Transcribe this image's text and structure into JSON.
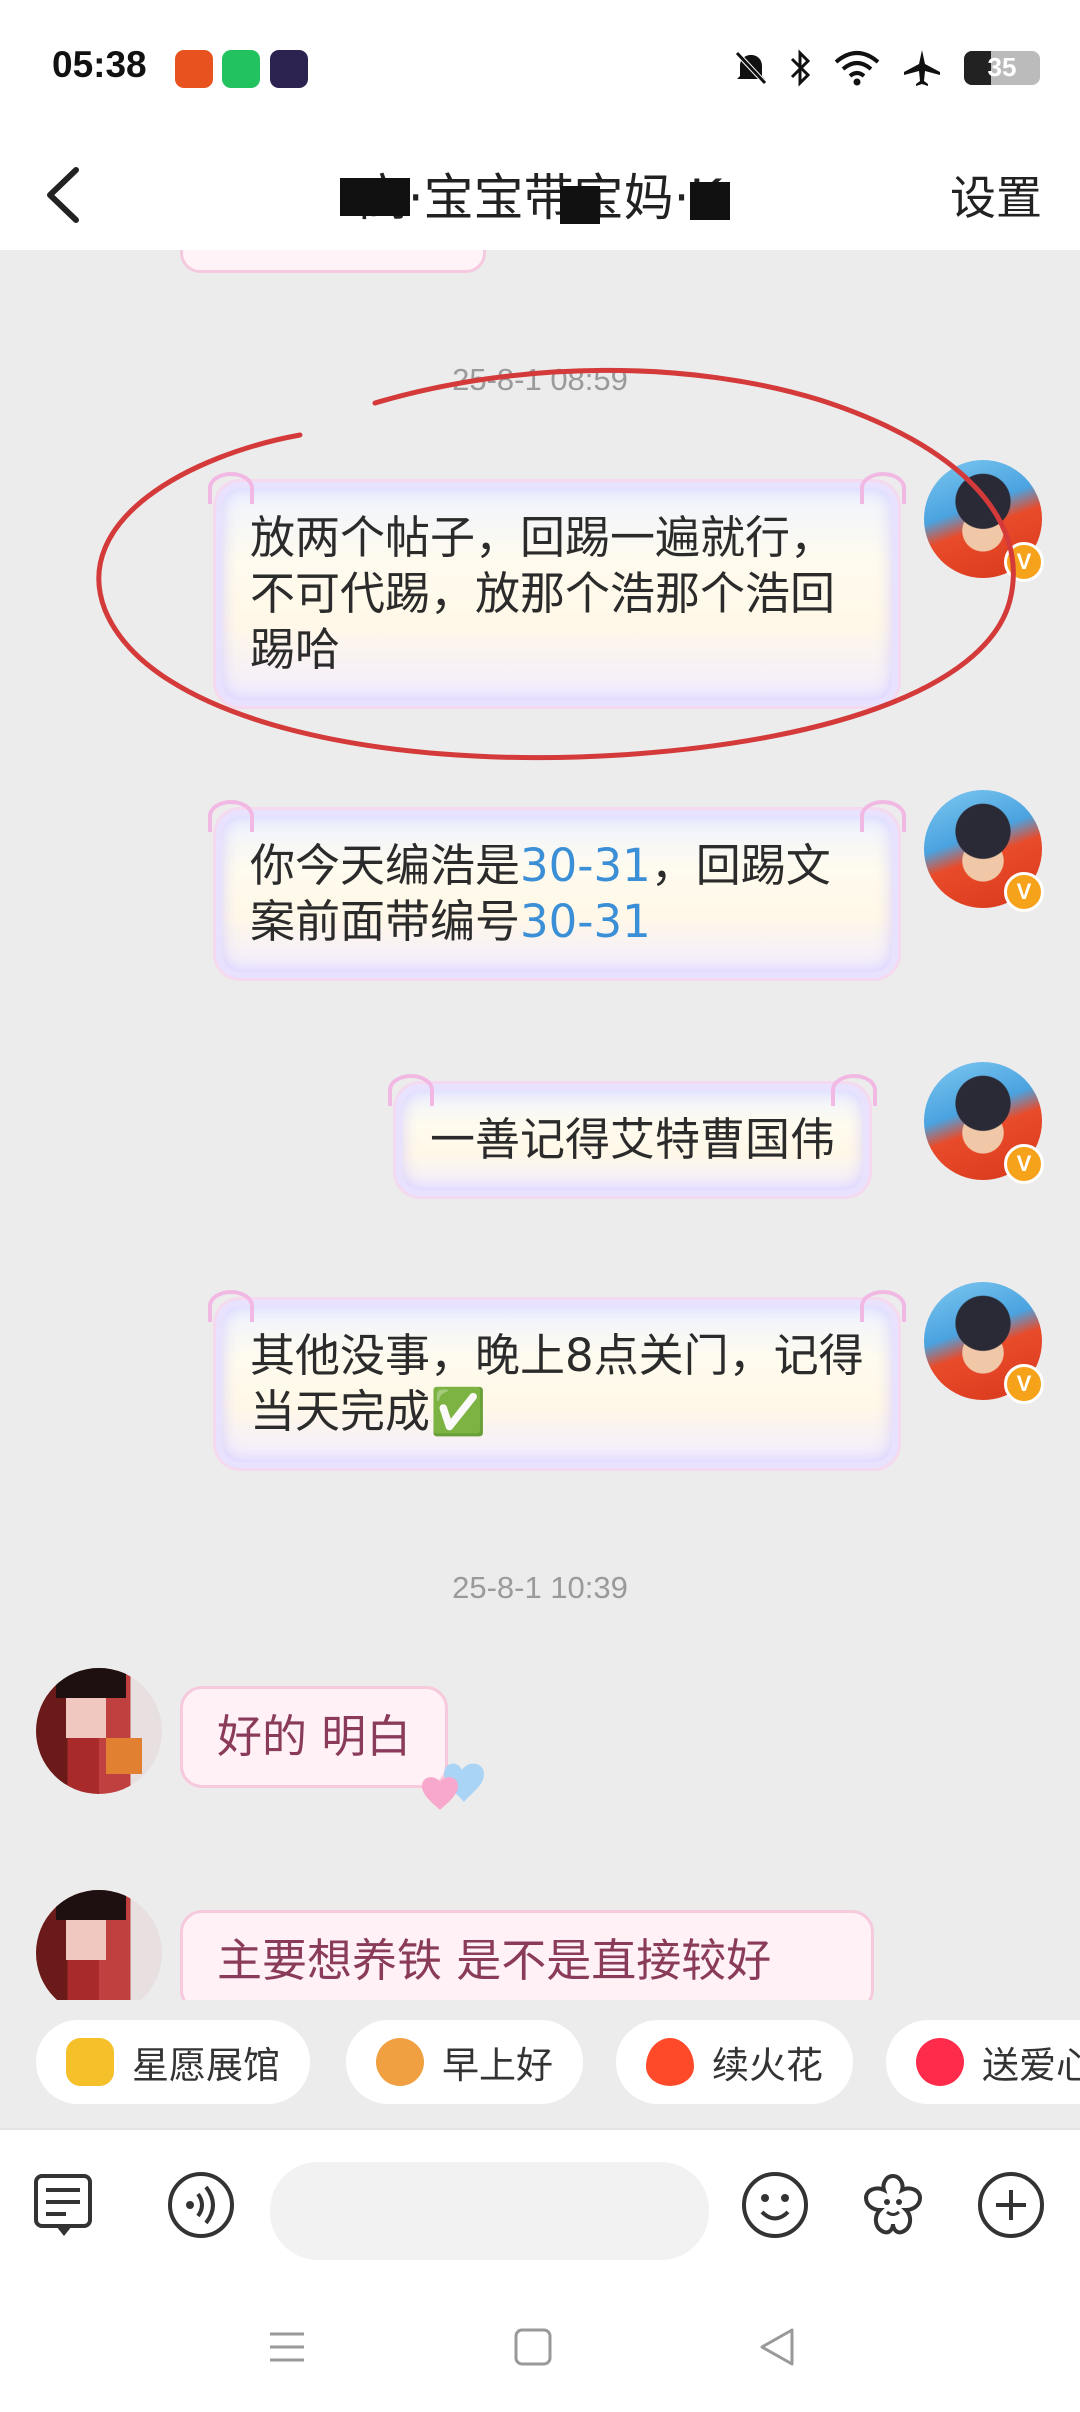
{
  "status_bar": {
    "time": "05:38",
    "battery_level": "35",
    "battery_fraction": 0.35
  },
  "header": {
    "title": "高·宝宝带宝妈·K",
    "settings_label": "设置",
    "back_icon": "chevron-left-icon"
  },
  "messages": [
    {
      "type": "timestamp",
      "text": "25-8-1 08:59"
    },
    {
      "type": "outgoing",
      "text": "放两个帖子，回踢一遍就行，不可代踢，放那个浩那个浩回踢哈"
    },
    {
      "type": "outgoing",
      "parts": [
        "你今天编浩是",
        "30-31",
        "，回踢文案前面带编号",
        "30-31"
      ]
    },
    {
      "type": "outgoing",
      "text": "一善记得艾特曹国伟"
    },
    {
      "type": "outgoing",
      "text": "其他没事，晚上8点关门，记得当天完成✅"
    },
    {
      "type": "timestamp",
      "text": "25-8-1 10:39"
    },
    {
      "type": "incoming",
      "text": "好的  明白"
    },
    {
      "type": "incoming",
      "text": "主要想养铁 是不是直接较好"
    }
  ],
  "quick_replies": [
    {
      "label": "星愿展馆",
      "icon": "star-icon",
      "color": "#f5c02a"
    },
    {
      "label": "早上好",
      "icon": "monkey-face-icon",
      "color": "#f0a040"
    },
    {
      "label": "续火花",
      "icon": "fire-icon",
      "color": "#ff4a2a"
    },
    {
      "label": "送爱心",
      "icon": "heart-icon",
      "color": "#ff2b4a"
    }
  ],
  "input_bar": {
    "placeholder": "",
    "icons": [
      "document-icon",
      "voice-icon",
      "emoji-icon",
      "flower-sticker-icon",
      "plus-icon"
    ]
  },
  "nav_bar": {
    "icons": [
      "menu-icon",
      "home-square-icon",
      "back-triangle-icon"
    ]
  },
  "colors": {
    "chat_background": "#ececec",
    "highlight_number": "#3b8fd6",
    "annotation_circle": "#d43a3a",
    "vip_badge": "#f7a21b"
  }
}
